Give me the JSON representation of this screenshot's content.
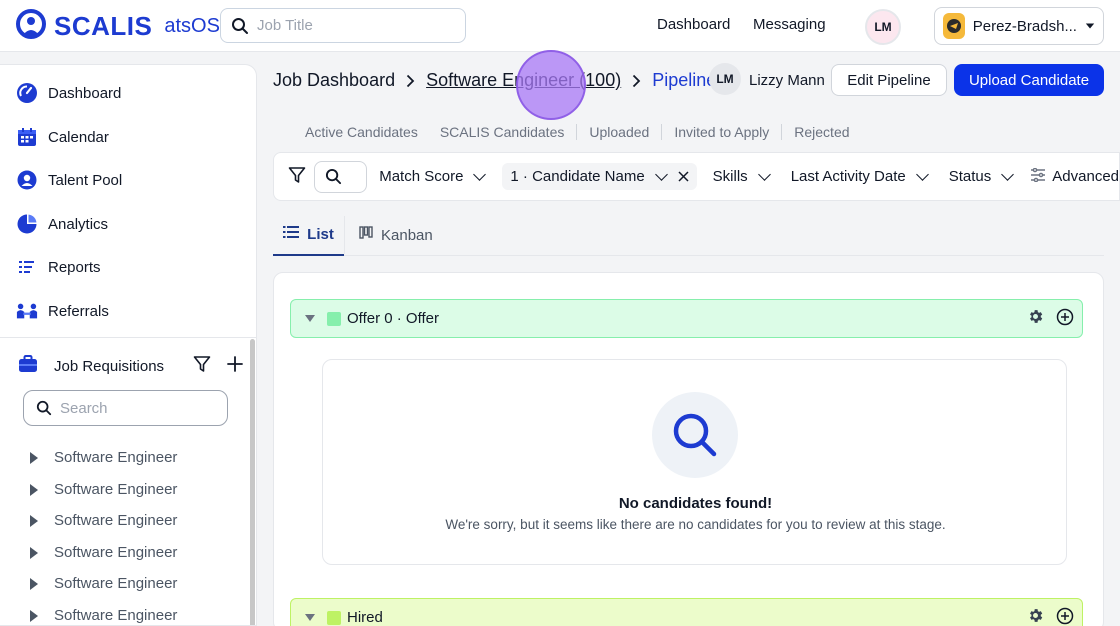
{
  "brand": {
    "name": "SCALIS",
    "suffix": "atsOS"
  },
  "colors": {
    "brand_blue": "#1d3bd1",
    "primary_button": "#0b33e8",
    "offer_stage": "#86efac",
    "hired_stage": "#bef264"
  },
  "top_search": {
    "placeholder": "Job Title",
    "value": ""
  },
  "top_nav": {
    "dashboard": "Dashboard",
    "messaging": "Messaging"
  },
  "user": {
    "initials": "LM"
  },
  "company": {
    "name": "Perez-Bradsh..."
  },
  "sidebar": {
    "nav": [
      {
        "label": "Dashboard",
        "icon": "dashboard-icon"
      },
      {
        "label": "Calendar",
        "icon": "calendar-icon"
      },
      {
        "label": "Talent Pool",
        "icon": "talent-pool-icon"
      },
      {
        "label": "Analytics",
        "icon": "analytics-icon"
      },
      {
        "label": "Reports",
        "icon": "reports-icon"
      },
      {
        "label": "Referrals",
        "icon": "referrals-icon"
      }
    ],
    "requisitions": {
      "title": "Job Requisitions",
      "search_placeholder": "Search",
      "items": [
        "Software Engineer",
        "Software Engineer",
        "Software Engineer",
        "Software Engineer",
        "Software Engineer",
        "Software Engineer"
      ]
    }
  },
  "breadcrumb": {
    "root": "Job Dashboard",
    "job": "Software Engineer (100)",
    "current": "Pipeline"
  },
  "recruiter": {
    "initials": "LM",
    "name": "Lizzy Mann"
  },
  "actions": {
    "edit_pipeline": "Edit Pipeline",
    "upload_candidate": "Upload Candidate"
  },
  "stage_tabs": [
    "Active Candidates",
    "SCALIS Candidates",
    "Uploaded",
    "Invited to Apply",
    "Rejected"
  ],
  "filters": {
    "match_score": "Match Score",
    "candidate_name": "1 · Candidate Name",
    "skills": "Skills",
    "last_activity": "Last Activity Date",
    "status": "Status",
    "advanced": "Advanced"
  },
  "view_tabs": {
    "list": "List",
    "kanban": "Kanban"
  },
  "stages": [
    {
      "label": "Offer 0 · Offer"
    },
    {
      "label": "Hired"
    }
  ],
  "empty_state": {
    "title": "No candidates found!",
    "message": "We're sorry, but it seems like there are no candidates for you to review at this stage."
  }
}
